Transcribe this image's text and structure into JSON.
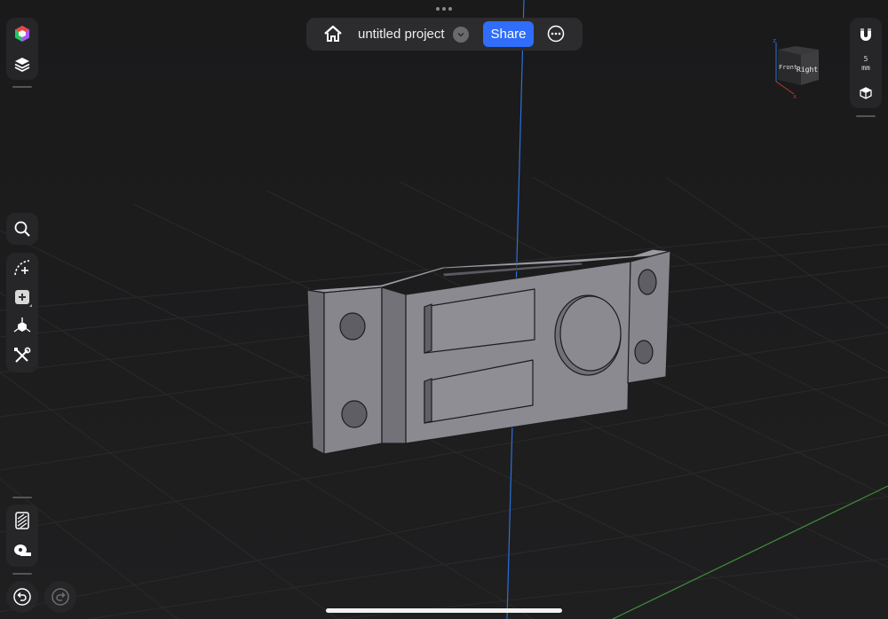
{
  "topbar": {
    "project_title": "untitled project",
    "share_label": "Share"
  },
  "viewcube": {
    "face_front": "Front",
    "face_right": "Right",
    "axis_z": "z",
    "axis_x": "x"
  },
  "snap": {
    "value": "5",
    "unit": "mm"
  },
  "icons": {
    "appearance": "color-cube-icon",
    "layers": "layers-icon",
    "search": "search-icon",
    "sketch": "sketch-arc-icon",
    "add_primitive": "add-primitive-icon",
    "transform": "transform-icon",
    "tools": "tools-icon",
    "section": "section-view-icon",
    "measure": "tape-measure-icon",
    "undo": "undo-icon",
    "redo": "redo-icon",
    "magnet": "magnet-icon",
    "view_mode": "view-cube-icon",
    "home": "home-icon",
    "dropdown": "chevron-down-icon",
    "more": "more-icon"
  },
  "colors": {
    "background": "#1b1b1c",
    "share_button": "#2f6dfa",
    "z_axis": "#2d6fd8",
    "x_axis": "#3f8f3a",
    "model": "#808086"
  }
}
